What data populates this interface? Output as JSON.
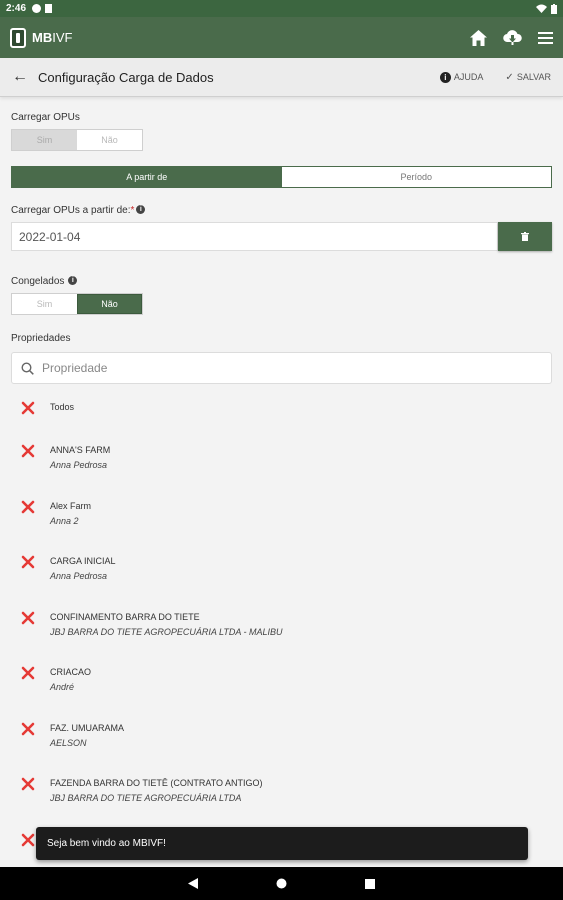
{
  "status_bar": {
    "time": "2:46"
  },
  "app_bar": {
    "logo_bold": "MB",
    "logo_light": "IVF",
    "icons": [
      "home-icon",
      "cloud-download-icon",
      "menu-icon"
    ]
  },
  "sub_bar": {
    "title": "Configuração Carga de Dados",
    "help_label": "AJUDA",
    "save_label": "SALVAR"
  },
  "form": {
    "carregar_opus_label": "Carregar OPUs",
    "carregar_opus_options": [
      "Sim",
      "Não"
    ],
    "carregar_opus_selected": "Sim",
    "segment_options": [
      "A partir de",
      "Período"
    ],
    "segment_selected": "A partir de",
    "date_label": "Carregar OPUs a partir de:",
    "date_required_mark": "*",
    "date_value": "2022-01-04",
    "congelados_label": "Congelados",
    "congelados_options": [
      "Sim",
      "Não"
    ],
    "congelados_selected": "Não",
    "propriedades_label": "Propriedades",
    "search_placeholder": "Propriedade"
  },
  "properties": [
    {
      "name": "Todos",
      "owner": ""
    },
    {
      "name": "ANNA'S FARM",
      "owner": "Anna Pedrosa"
    },
    {
      "name": "Alex Farm",
      "owner": "Anna 2"
    },
    {
      "name": "CARGA INICIAL",
      "owner": "Anna Pedrosa"
    },
    {
      "name": "CONFINAMENTO BARRA DO TIETE",
      "owner": "JBJ BARRA DO TIETE AGROPECUÁRIA LTDA - MALIBU"
    },
    {
      "name": "CRIACAO",
      "owner": "André"
    },
    {
      "name": "FAZ. UMUARAMA",
      "owner": "AELSON"
    },
    {
      "name": "FAZENDA BARRA DO TIETÊ (CONTRATO ANTIGO)",
      "owner": "JBJ BARRA DO TIETE AGROPECUÁRIA LTDA"
    },
    {
      "name": "",
      "owner": ""
    }
  ],
  "snackbar": {
    "message": "Seja bem vindo ao MBIVF!"
  },
  "colors": {
    "primary": "#4a6b4b",
    "status_bar": "#3c6640",
    "remove_x": "#e53935"
  }
}
